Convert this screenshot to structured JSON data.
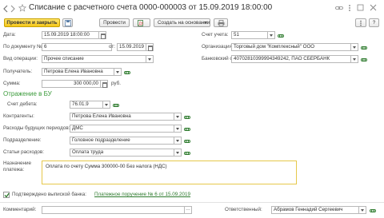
{
  "title": "Списание с расчетного счета 0000-000003 от 15.09.2019 18:00:00",
  "toolbar": {
    "post_close": "Провести и закрыть",
    "post": "Провести",
    "create_based_on": "Создать на основании",
    "more_icon": "more-vertical-icon",
    "help": "?"
  },
  "fields": {
    "date_label": "Дата:",
    "date_value": "15.09.2019 18:00:00",
    "doc_no_label": "По документу №:",
    "doc_no_value": "6",
    "from_label": "от:",
    "from_value": "15.09.2019",
    "account_label": "Счет учета:",
    "account_value": "51",
    "org_label": "Организация:",
    "org_value": "Торговый дом \"Комплексный\" ООО",
    "bank_label": "Банковский счет:",
    "bank_value": "40702810399994349242, ПАО СБЕРБАНК",
    "op_type_label": "Вид операции:",
    "op_type_value": "Прочее списание",
    "recipient_label": "Получатель:",
    "recipient_value": "Петрова Елена Ивановна",
    "sum_label": "Сумма:",
    "sum_value": "300 000,00",
    "currency": "руб."
  },
  "bu": {
    "section_title": "Отражение в БУ",
    "debit_label": "Счет дебета:",
    "debit_value": "76.01.9",
    "counterparties_label": "Контрагенты:",
    "counterparties_value": "Петрова Елена Ивановна",
    "rbp_label": "Расходы будущих периодов:",
    "rbp_value": "ДМС",
    "division_label": "Подразделение:",
    "division_value": "Головное подразделение",
    "expense_label": "Статьи расходов:",
    "expense_value": "Оплата труда"
  },
  "purpose": {
    "label_line1": "Назначение",
    "label_line2": "платежа:",
    "value": "Оплата по счету Сумма 300000-00 Без налога (НДС)"
  },
  "confirmation": {
    "checkbox_label": "Подтверждено выпиской банка:",
    "checked": true,
    "link": "Платежное поручение № 6 от 15.09.2019"
  },
  "footer": {
    "comment_label": "Комментарий:",
    "comment_value": "",
    "responsible_label": "Ответственный:",
    "responsible_value": "Абрамов Геннадий Сергеевич"
  },
  "colors": {
    "accent_yellow": "#f5c71a",
    "section_green": "#3a9a3a",
    "link_green": "#2d7a2d",
    "textarea_border": "#e6c84a"
  }
}
